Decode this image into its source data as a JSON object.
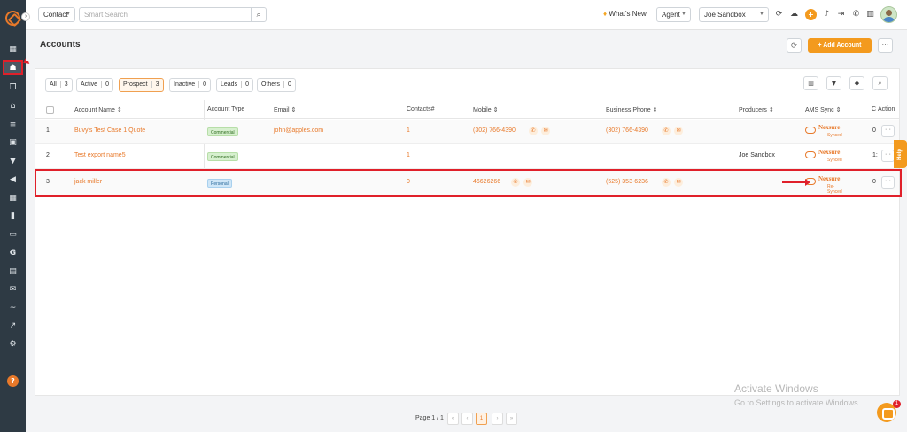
{
  "colors": {
    "accent": "#f39a1e",
    "sidebar": "#2e3a44",
    "highlight": "#e0202a"
  },
  "sidebar": {
    "icons": [
      "dashboard-icon",
      "accounts-icon",
      "copy-icon",
      "bank-icon",
      "list-icon",
      "contact-card-icon",
      "filter-icon",
      "megaphone-icon",
      "grid-icon",
      "bar-chart-icon",
      "folder-icon",
      "g-icon",
      "calendar-icon",
      "mail-icon",
      "activity-icon",
      "line-chart-icon",
      "settings-icon",
      "help-icon"
    ],
    "help_glyph": "?"
  },
  "topbar": {
    "search_type": "Contact",
    "search_placeholder": "Smart Search",
    "whats_new": "What's New",
    "role": "Agent",
    "user": "Joe Sandbox"
  },
  "page": {
    "title": "Accounts",
    "add_button": "+ Add Account",
    "more": "···"
  },
  "filters": [
    {
      "label": "All",
      "count": "3"
    },
    {
      "label": "Active",
      "count": "0"
    },
    {
      "label": "Prospect",
      "count": "3"
    },
    {
      "label": "Inactive",
      "count": "0"
    },
    {
      "label": "Leads",
      "count": "0"
    },
    {
      "label": "Others",
      "count": "0"
    }
  ],
  "table": {
    "headers": [
      "Account Name",
      "Account Type",
      "Email",
      "Contacts#",
      "Mobile",
      "Business Phone",
      "Producers",
      "AMS Sync",
      "C",
      "Action"
    ],
    "rows": [
      {
        "num": "1",
        "name": "Buvy's Test Case 1 Quote",
        "type": "Commercial",
        "email": "john@apples.com",
        "contacts": "1",
        "mobile": "(302) 766-4390",
        "business_phone": "(302) 766-4390",
        "producer": "",
        "ams_name": "Nexsure",
        "ams_status": "Synced",
        "c": "0",
        "action": "···"
      },
      {
        "num": "2",
        "name": "Test export name5",
        "type": "Commercial",
        "email": "",
        "contacts": "1",
        "mobile": "",
        "business_phone": "",
        "producer": "Joe Sandbox",
        "ams_name": "Nexsure",
        "ams_status": "Synced",
        "c": "1:",
        "action": "···"
      },
      {
        "num": "3",
        "name": "jack miller",
        "type": "Personal",
        "email": "",
        "contacts": "0",
        "mobile": "46626266",
        "business_phone": "(525) 353-6236",
        "producer": "",
        "ams_name": "Nexsure",
        "ams_status": "Re-Synced",
        "c": "0",
        "action": "···"
      }
    ]
  },
  "pagination": {
    "label": "Page 1 / 1",
    "first": "«",
    "prev": "‹",
    "current": "1",
    "next": "›",
    "last": "»"
  },
  "watermark": {
    "title": "Activate Windows",
    "subtitle": "Go to Settings to activate Windows."
  },
  "help_tab": "Help",
  "chat_badge": "1"
}
